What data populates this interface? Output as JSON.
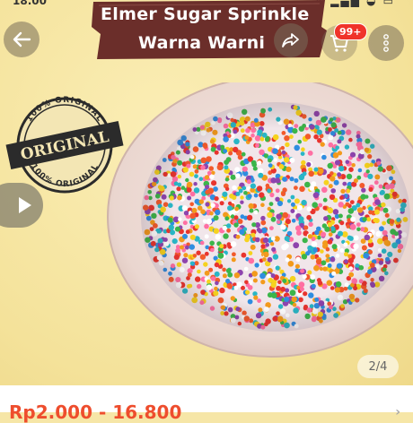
{
  "status_bar": {
    "time": "18.00",
    "icons": "⚬ ▂▄▆ ◒ ▭"
  },
  "product": {
    "title_line1": "Elmer Sugar Sprinkle",
    "title_line2": "Warna Warni",
    "image_counter": "2/4",
    "price": "Rp2.000 - 16.800"
  },
  "stamp": {
    "top_text": "100% ORIGINAL",
    "center_text": "ORIGINAL",
    "bottom_text": "100% ORIGINAL"
  },
  "cart": {
    "badge": "99+"
  },
  "icons": {
    "back": "arrow-left-icon",
    "share": "share-icon",
    "cart": "cart-icon",
    "more": "more-vertical-icon",
    "play": "play-icon"
  },
  "colors": {
    "background": "#f4e29a",
    "banner": "#6b2e2a",
    "price": "#ee4d2d",
    "badge": "#f0332a"
  }
}
